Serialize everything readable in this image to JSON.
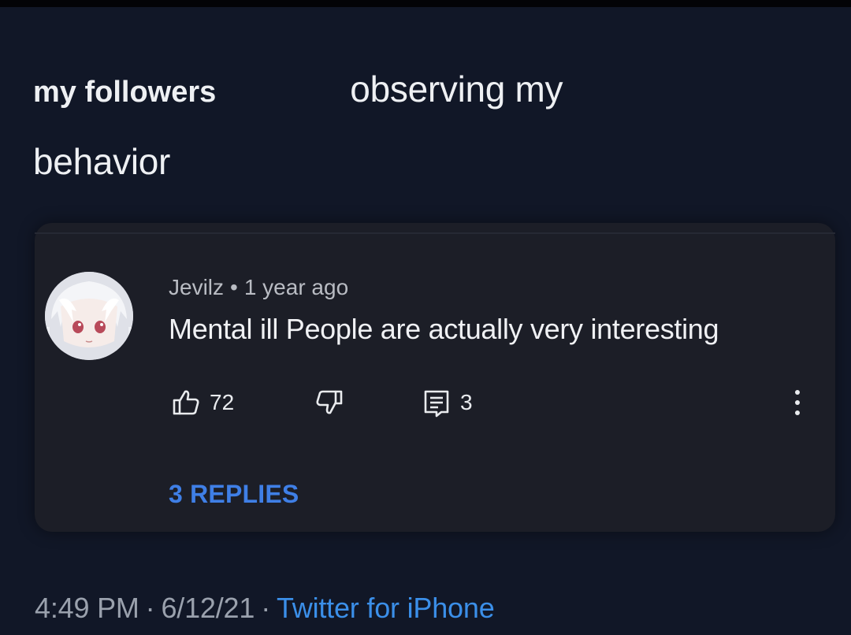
{
  "tweet": {
    "text_bold": "my  followers",
    "text_rest_1": "observing my",
    "text_rest_2": "behavior"
  },
  "comment": {
    "author": "Jevilz",
    "separator": "•",
    "time_ago": "1 year ago",
    "body": "Mental ill People are actually very interesting",
    "like_count": "72",
    "reply_count": "3",
    "replies_link": "3 REPLIES",
    "icons": {
      "like": "thumbs-up-icon",
      "dislike": "thumbs-down-icon",
      "reply": "comment-icon",
      "more": "more-vertical-icon"
    }
  },
  "footer": {
    "time": "4:49 PM",
    "separator": "·",
    "date": "6/12/21",
    "source": "Twitter for iPhone"
  },
  "colors": {
    "background": "#111727",
    "card": "#1c1e27",
    "link_blue": "#3f7fe6",
    "source_blue": "#3b8fe9"
  }
}
